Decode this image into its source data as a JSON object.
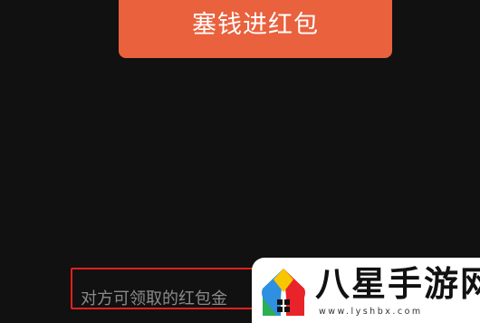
{
  "send_button": {
    "label": "塞钱进红包"
  },
  "notice": {
    "text": "对方可领取的红包金"
  },
  "watermark": {
    "title": "八星手游网",
    "url": "www.lyshbx.com",
    "logo_icon": "house-logo-icon"
  },
  "colors": {
    "background": "#111111",
    "button": "#E9613D",
    "highlight_border": "#E0201F",
    "notice_text": "#8a8a8a"
  }
}
